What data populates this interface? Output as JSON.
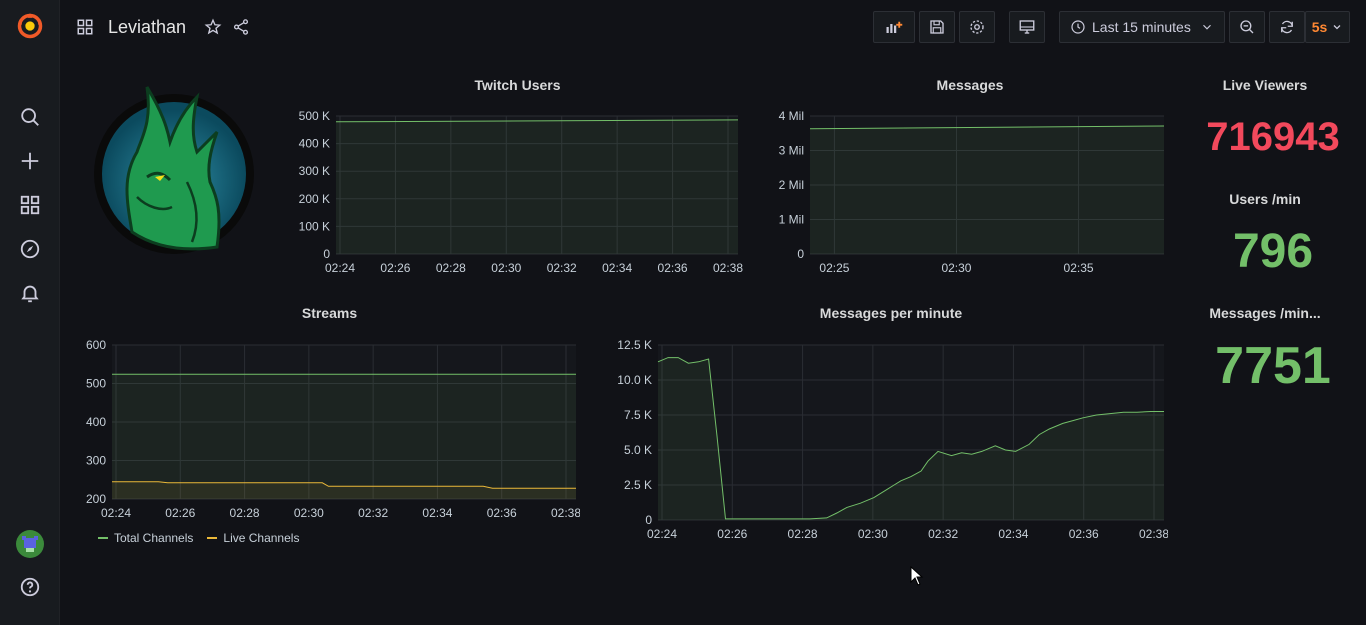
{
  "dashboard": {
    "title": "Leviathan"
  },
  "toolbar": {
    "time_range": "Last 15 minutes",
    "refresh_rate": "5s"
  },
  "colors": {
    "green": "#73bf69",
    "yellow": "#eab839",
    "red": "#f2495c",
    "orange": "#ff8833"
  },
  "stats": [
    {
      "label": "Live Viewers",
      "value": "716943",
      "color": "#f2495c"
    },
    {
      "label": "Users /min",
      "value": "796",
      "color": "#73bf69"
    },
    {
      "label": "Messages /min...",
      "value": "7751",
      "color": "#73bf69"
    }
  ],
  "chart_data": [
    {
      "id": "twitch-users",
      "type": "line",
      "title": "Twitch Users",
      "x_ticks": [
        "02:24",
        "02:26",
        "02:28",
        "02:30",
        "02:32",
        "02:34",
        "02:36",
        "02:38"
      ],
      "y_ticks": [
        "0",
        "100 K",
        "200 K",
        "300 K",
        "400 K",
        "500 K"
      ],
      "ylim": [
        0,
        500000
      ],
      "xlim": [
        0,
        15
      ],
      "series": [
        {
          "color": "#73bf69",
          "x": [
            0,
            15
          ],
          "y": [
            479000,
            486000
          ]
        }
      ]
    },
    {
      "id": "messages",
      "type": "line",
      "title": "Messages",
      "x_ticks": [
        "02:25",
        "02:30",
        "02:35"
      ],
      "x_tick_pos": [
        1,
        6,
        11
      ],
      "y_ticks": [
        "0",
        "1 Mil",
        "2 Mil",
        "3 Mil",
        "4 Mil"
      ],
      "ylim": [
        0,
        4000000
      ],
      "xlim": [
        0,
        14.5
      ],
      "series": [
        {
          "color": "#73bf69",
          "x": [
            0,
            14.5
          ],
          "y": [
            3630000,
            3710000
          ]
        }
      ]
    },
    {
      "id": "streams",
      "type": "line",
      "title": "Streams",
      "x_ticks": [
        "02:24",
        "02:26",
        "02:28",
        "02:30",
        "02:32",
        "02:34",
        "02:36",
        "02:38"
      ],
      "y_ticks": [
        "200",
        "300",
        "400",
        "500",
        "600"
      ],
      "ylim": [
        200,
        600
      ],
      "xlim": [
        0,
        15
      ],
      "series": [
        {
          "name": "Total Channels",
          "color": "#73bf69",
          "x": [
            0,
            15
          ],
          "y": [
            524,
            524
          ]
        },
        {
          "name": "Live Channels",
          "color": "#eab839",
          "x": [
            0,
            1.5,
            1.8,
            6.8,
            7,
            12,
            12.3,
            15
          ],
          "y": [
            245,
            245,
            242,
            242,
            233,
            233,
            228,
            228
          ]
        }
      ]
    },
    {
      "id": "messages-per-minute",
      "type": "area",
      "title": "Messages per minute",
      "x_ticks": [
        "02:24",
        "02:26",
        "02:28",
        "02:30",
        "02:32",
        "02:34",
        "02:36",
        "02:38"
      ],
      "y_ticks": [
        "0",
        "2.5 K",
        "5.0 K",
        "7.5 K",
        "10.0 K",
        "12.5 K"
      ],
      "ylim": [
        0,
        12500
      ],
      "xlim": [
        0,
        15
      ],
      "series": [
        {
          "color": "#73bf69",
          "x": [
            0,
            0.3,
            0.6,
            0.9,
            1.2,
            1.5,
            1.75,
            2.0,
            2.5,
            3.0,
            3.5,
            4.0,
            4.5,
            5.0,
            5.3,
            5.6,
            6.0,
            6.4,
            6.8,
            7.0,
            7.2,
            7.5,
            7.8,
            8.0,
            8.3,
            8.7,
            9.0,
            9.3,
            9.6,
            10.0,
            10.3,
            10.6,
            11.0,
            11.3,
            11.6,
            12.0,
            12.3,
            12.6,
            13.0,
            13.4,
            13.8,
            14.2,
            14.6,
            15.0
          ],
          "y": [
            11300,
            11600,
            11600,
            11200,
            11300,
            11500,
            6000,
            80,
            80,
            80,
            80,
            80,
            80,
            150,
            500,
            900,
            1200,
            1600,
            2200,
            2500,
            2800,
            3100,
            3500,
            4200,
            4900,
            4600,
            4800,
            4700,
            4900,
            5300,
            5000,
            4900,
            5400,
            6100,
            6500,
            6900,
            7100,
            7300,
            7500,
            7600,
            7700,
            7700,
            7750,
            7751
          ]
        }
      ]
    }
  ]
}
